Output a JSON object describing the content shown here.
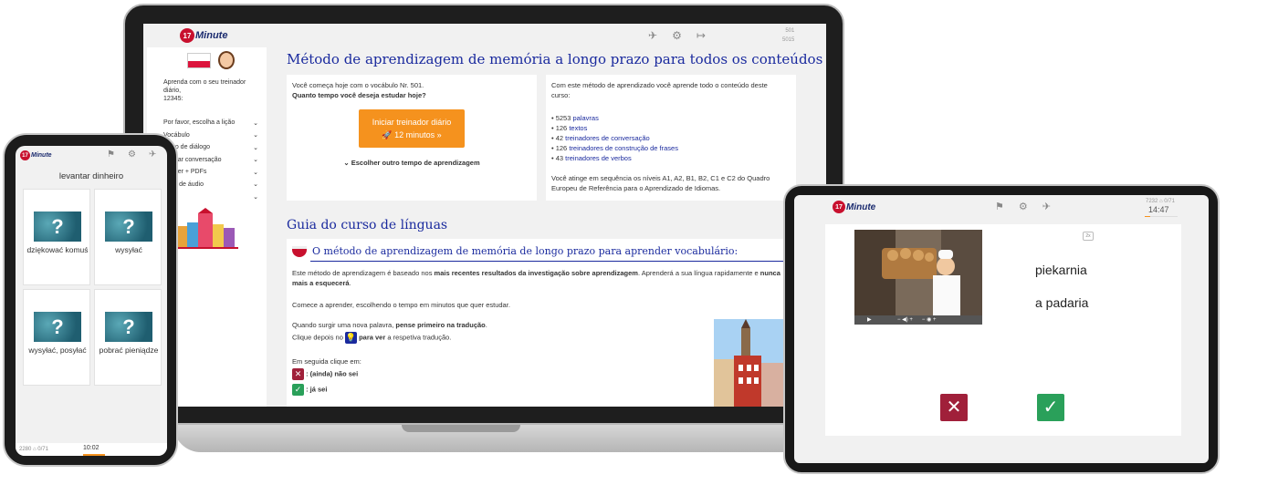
{
  "laptop": {
    "logo_number": "17",
    "logo_word": "Minute",
    "top_stats": [
      "501",
      "5015"
    ],
    "sidebar": {
      "trainer_text_1": "Aprenda com o seu treinador diário,",
      "trainer_text_2": "12345:",
      "items": [
        {
          "label": "Por favor, escolha a lição"
        },
        {
          "label": "Vocábulo"
        },
        {
          "label": "Texto de diálogo"
        },
        {
          "label": "Treinar conversação"
        },
        {
          "label": "Trainer + PDFs"
        },
        {
          "label": "Livro de áudio"
        },
        {
          "label": ""
        }
      ]
    },
    "main": {
      "title": "Método de aprendizagem de memória a longo prazo para todos os conteúdos deste curso",
      "left_card": {
        "line1": "Você começa hoje com o vocábulo Nr. 501.",
        "line2": "Quanto tempo você deseja estudar hoje?",
        "button_line1": "Iniciar treinador diário",
        "button_line2": "12 minutos",
        "other_time": "Escolher outro tempo de aprendizagem"
      },
      "right_card": {
        "intro": "Com este método de aprendizado você aprende todo o conteúdo deste curso:",
        "items": [
          {
            "count": "5253",
            "label": "palavras"
          },
          {
            "count": "126",
            "label": "textos"
          },
          {
            "count": "42",
            "label": "treinadores de conversação"
          },
          {
            "count": "126",
            "label": "treinadores de construção de frases"
          },
          {
            "count": "43",
            "label": "treinadores de verbos"
          }
        ],
        "outro": "Você atinge em sequência os níveis A1, A2, B1, B2, C1 e C2 do Quadro Europeu de Referência para o Aprendizado de Idiomas."
      },
      "guide_title": "Guia do curso de línguas",
      "guide": {
        "heading": "O método de aprendizagem de memória de longo prazo para aprender vocabulário:",
        "p1_a": "Este método de aprendizagem é baseado nos ",
        "p1_b": "mais recentes resultados da investigação sobre aprendizagem",
        "p1_c": ". Aprenderá a sua língua rapidamente e ",
        "p1_d": "nunca",
        "p1_e": "mais a esquecerá",
        "p1_f": ".",
        "p2": "Comece a aprender, escolhendo o tempo em minutos que quer estudar.",
        "p3_a": "Quando surgir uma nova palavra, ",
        "p3_b": "pense primeiro na tradução",
        "p3_c": ".",
        "p4_a": "Clique depois no",
        "p4_b": "para ver",
        "p4_c": "a respetiva tradução.",
        "p5": "Em seguida clique em:",
        "no_label": ": (ainda) não sei",
        "yes_label": ": já sei"
      }
    }
  },
  "phone": {
    "logo_number": "17",
    "logo_word": "Minute",
    "prompt": "levantar dinheiro",
    "tiles": [
      {
        "label": "dziękować komuś"
      },
      {
        "label": "wysyłać"
      },
      {
        "label": "wysyłać, posyłać"
      },
      {
        "label": "pobrać pieniądze"
      }
    ],
    "stats": "2280 ⌂ 0/71",
    "time": "10:02"
  },
  "tablet": {
    "logo_number": "17",
    "logo_word": "Minute",
    "stats": "7232 ⌂ 0/71",
    "time": "14:47",
    "word_pl": "piekarnia",
    "word_pt": "a padaria",
    "speed": "2x"
  },
  "colors": {
    "brand_red": "#c8102e",
    "brand_navy": "#1a2a9e",
    "orange": "#f5921e",
    "no_red": "#a0203a",
    "yes_green": "#2aa05a"
  }
}
